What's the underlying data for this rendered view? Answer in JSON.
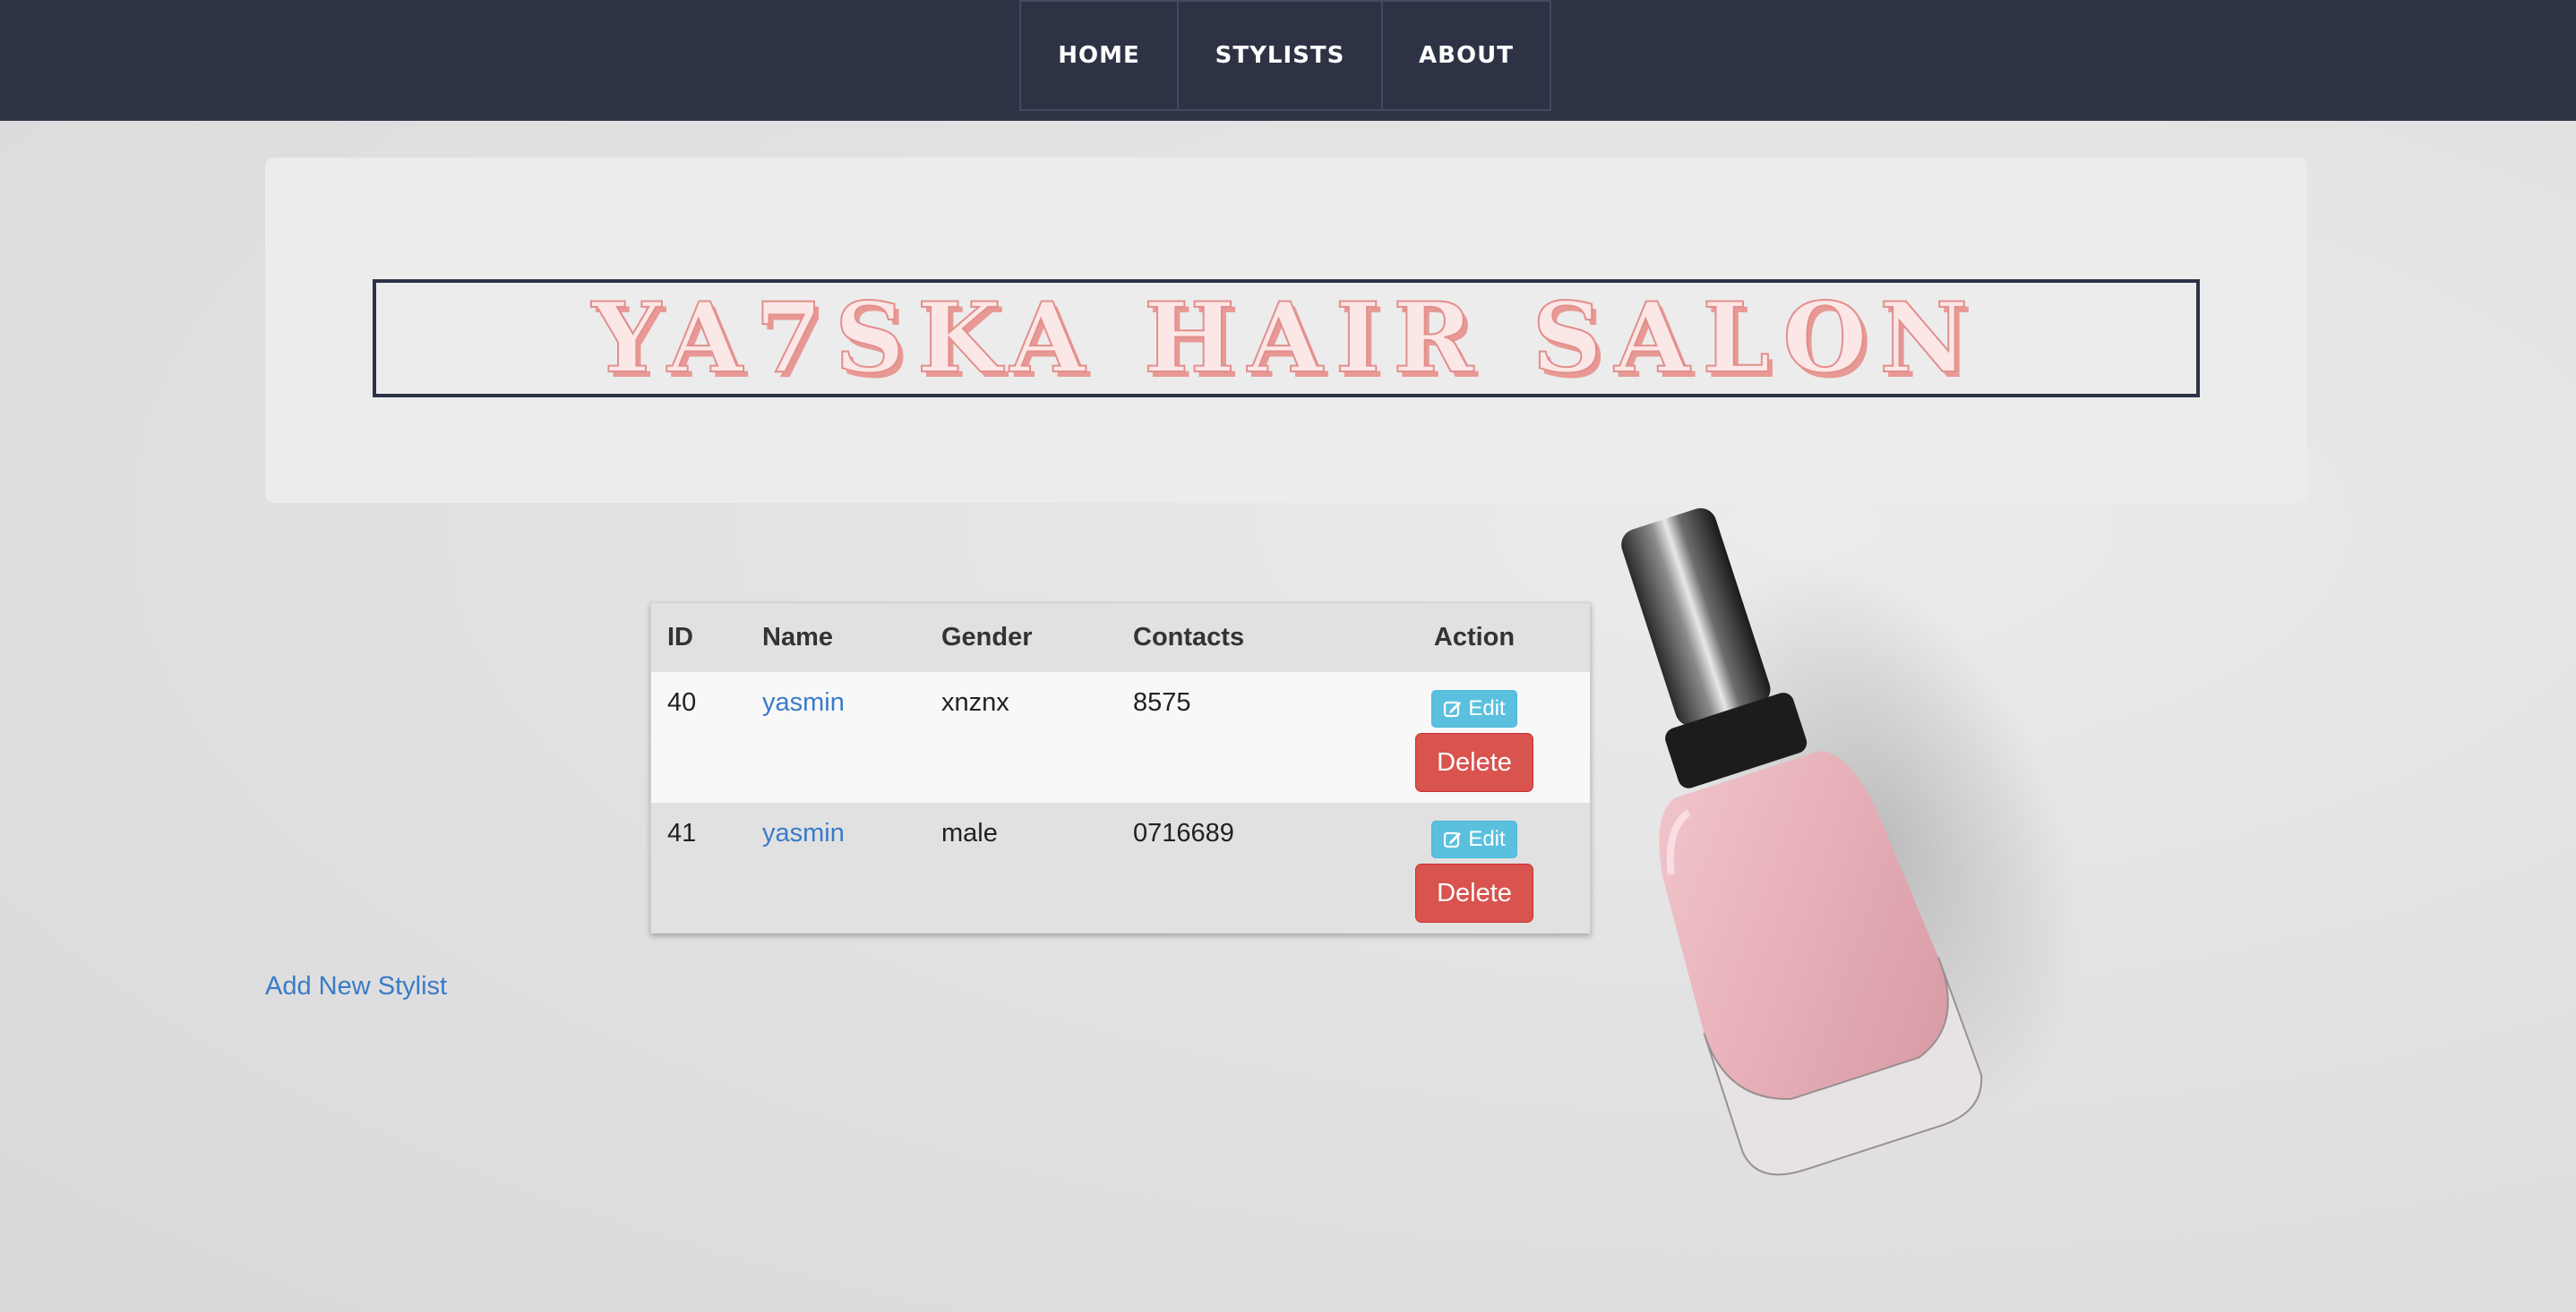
{
  "nav": {
    "items": [
      {
        "label": "HOME"
      },
      {
        "label": "STYLISTS"
      },
      {
        "label": "ABOUT"
      }
    ]
  },
  "header": {
    "title": "YA7SKA HAIR SALON"
  },
  "table": {
    "columns": [
      "ID",
      "Name",
      "Gender",
      "Contacts",
      "Action"
    ],
    "rows": [
      {
        "id": "40",
        "name": "yasmin",
        "gender": "xnznx",
        "contacts": "8575",
        "edit_label": "Edit",
        "delete_label": "Delete"
      },
      {
        "id": "41",
        "name": "yasmin",
        "gender": "male",
        "contacts": "0716689",
        "edit_label": "Edit",
        "delete_label": "Delete"
      }
    ]
  },
  "add_link": "Add New Stylist",
  "colors": {
    "navbar": "#2d3345",
    "title_fill": "#fbe7e6",
    "title_accent": "#e89995",
    "link": "#3a7bc8",
    "edit_button": "#5bc0de",
    "delete_button": "#d9534f"
  },
  "icons": {
    "edit": "edit-icon",
    "decoration": "nail-polish-image"
  }
}
